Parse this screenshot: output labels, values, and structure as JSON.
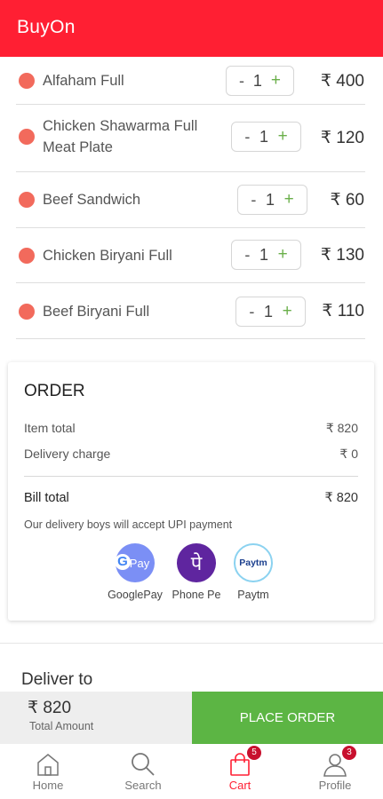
{
  "app": {
    "title": "BuyOn"
  },
  "items": [
    {
      "name_lines": [
        "Alfaham Full"
      ],
      "qty": "1",
      "minus": "-",
      "plus": "+",
      "price": "₹ 400"
    },
    {
      "name_lines": [
        "Chicken Shawarma Full",
        "Meat Plate"
      ],
      "qty": "1",
      "minus": "-",
      "plus": "+",
      "price": "₹ 120"
    },
    {
      "name_lines": [
        "Beef Sandwich"
      ],
      "qty": "1",
      "minus": "-",
      "plus": "+",
      "price": "₹ 60"
    },
    {
      "name_lines": [
        "Chicken Biryani Full"
      ],
      "qty": "1",
      "minus": "-",
      "plus": "+",
      "price": "₹ 130"
    },
    {
      "name_lines": [
        "Beef Biryani Full"
      ],
      "qty": "1",
      "minus": "-",
      "plus": "+",
      "price": "₹ 110"
    }
  ],
  "order": {
    "title": "ORDER",
    "item_total_label": "Item total",
    "item_total_value": "₹ 820",
    "delivery_label": "Delivery charge",
    "delivery_value": "₹ 0",
    "bill_total_label": "Bill total",
    "bill_total_value": "₹ 820",
    "upi_note": "Our delivery boys will accept UPI payment",
    "payment_options": [
      {
        "label": "GooglePay",
        "icon": "google-pay-icon",
        "logo_text": "Pay"
      },
      {
        "label": "Phone Pe",
        "icon": "phonepe-icon",
        "logo_text": "पे"
      },
      {
        "label": "Paytm",
        "icon": "paytm-icon",
        "logo_text": "Paytm"
      }
    ]
  },
  "deliver": {
    "label": "Deliver to"
  },
  "checkout": {
    "total_amount": "₹ 820",
    "total_caption": "Total Amount",
    "place_order_label": "PLACE ORDER"
  },
  "nav": {
    "items": [
      {
        "label": "Home",
        "icon": "home-icon"
      },
      {
        "label": "Search",
        "icon": "search-icon"
      },
      {
        "label": "Cart",
        "icon": "cart-icon",
        "badge": "5",
        "active": true
      },
      {
        "label": "Profile",
        "icon": "profile-icon",
        "badge": "3"
      }
    ]
  },
  "colors": {
    "brand": "#ff1f33",
    "accent_green": "#5cb544",
    "dot": "#f26a5c",
    "badge": "#c8102e"
  }
}
